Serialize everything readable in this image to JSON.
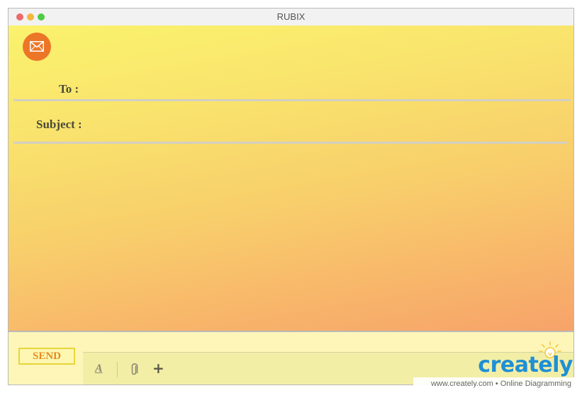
{
  "window": {
    "title": "RUBIX"
  },
  "compose": {
    "to_label": "To :",
    "subject_label": "Subject :",
    "icon": "envelope-icon",
    "colors": {
      "gradient_top": "#fbf26d",
      "gradient_bottom": "#f7a36a",
      "badge": "#ec7627"
    }
  },
  "bottom_bar": {
    "send_label": "SEND",
    "format_label": "A",
    "plus_label": "+",
    "icons": [
      "text-format-icon",
      "paperclip-icon",
      "plus-icon"
    ]
  },
  "watermark": {
    "logo_text": "creately",
    "caption": "www.creately.com • Online Diagramming"
  }
}
